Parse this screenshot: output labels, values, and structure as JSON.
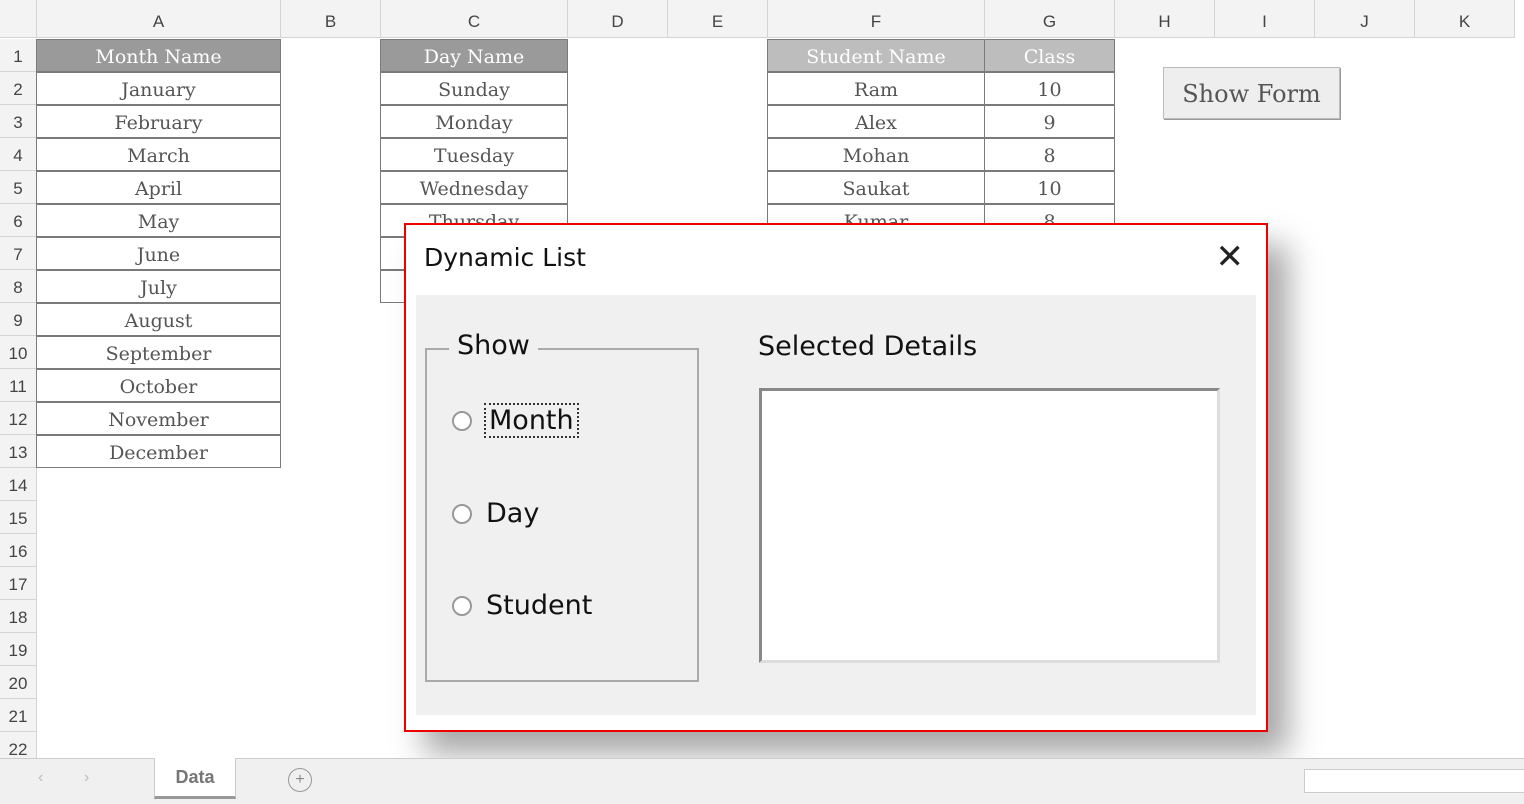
{
  "columns": [
    "A",
    "B",
    "C",
    "D",
    "E",
    "F",
    "G",
    "H",
    "I",
    "J",
    "K"
  ],
  "rows": [
    "1",
    "2",
    "3",
    "4",
    "5",
    "6",
    "7",
    "8",
    "9",
    "10",
    "11",
    "12",
    "13",
    "14",
    "15",
    "16",
    "17",
    "18",
    "19",
    "20",
    "21",
    "22"
  ],
  "months": {
    "header": "Month Name",
    "items": [
      "January",
      "February",
      "March",
      "April",
      "May",
      "June",
      "July",
      "August",
      "September",
      "October",
      "November",
      "December"
    ]
  },
  "days": {
    "header": "Day Name",
    "items": [
      "Sunday",
      "Monday",
      "Tuesday",
      "Wednesday",
      "Thursday",
      "",
      ""
    ]
  },
  "students": {
    "header_name": "Student Name",
    "header_class": "Class",
    "items": [
      {
        "name": "Ram",
        "class": "10"
      },
      {
        "name": "Alex",
        "class": "9"
      },
      {
        "name": "Mohan",
        "class": "8"
      },
      {
        "name": "Saukat",
        "class": "10"
      },
      {
        "name": "Kumar",
        "class": "8"
      }
    ]
  },
  "show_form_button": "Show Form",
  "dialog": {
    "title": "Dynamic List",
    "close_icon": "close-icon",
    "frame_label": "Show",
    "options": [
      "Month",
      "Day",
      "Student"
    ],
    "focused_option": "Month",
    "details_label": "Selected Details"
  },
  "sheet_tabs": {
    "active": "Data",
    "add_icon": "plus-circle-icon"
  }
}
